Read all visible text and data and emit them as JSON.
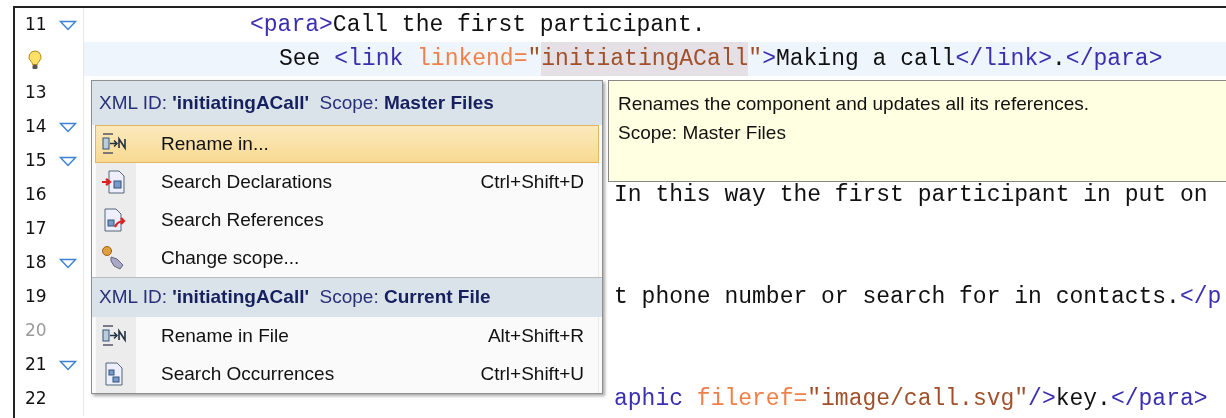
{
  "editor": {
    "lines": [
      {
        "number": "11",
        "fold": true,
        "current": false,
        "dimmed": false,
        "kind": "code",
        "segments": [
          {
            "kind": "tag",
            "text": "<para>"
          },
          {
            "kind": "text",
            "text": "Call the first participant."
          }
        ]
      },
      {
        "fold": false,
        "current": true,
        "kind": "code",
        "segments": [
          {
            "kind": "text",
            "text": "See "
          },
          {
            "kind": "tag",
            "text": "<link "
          },
          {
            "kind": "attr",
            "text": "linkend="
          },
          {
            "kind": "value",
            "text": "\""
          },
          {
            "kind": "value",
            "text": "initiatingACall",
            "highlighted": true
          },
          {
            "kind": "value",
            "text": "\""
          },
          {
            "kind": "tag",
            "text": ">"
          },
          {
            "kind": "text",
            "text": "Making a call"
          },
          {
            "kind": "tag",
            "text": "</link>"
          },
          {
            "kind": "text",
            "text": "."
          },
          {
            "kind": "tag",
            "text": "</para>"
          }
        ]
      },
      {
        "number": "13",
        "fold": false,
        "current": false,
        "dimmed": false
      },
      {
        "number": "14",
        "fold": true,
        "current": false,
        "dimmed": false
      },
      {
        "number": "15",
        "fold": true,
        "current": false,
        "dimmed": false
      },
      {
        "number": "16",
        "fold": false,
        "current": false,
        "dimmed": false,
        "kind": "tail",
        "segments": [
          {
            "kind": "text",
            "text": "In this way the first participant in put on"
          }
        ]
      },
      {
        "number": "17",
        "fold": false,
        "current": false,
        "dimmed": false
      },
      {
        "number": "18",
        "fold": true,
        "current": false,
        "dimmed": false
      },
      {
        "number": "19",
        "fold": false,
        "current": false,
        "dimmed": false,
        "kind": "tail",
        "segments": [
          {
            "kind": "text",
            "text": "t phone number or search for in contacts."
          },
          {
            "kind": "tag",
            "text": "</p"
          }
        ]
      },
      {
        "number": "20",
        "fold": false,
        "current": false,
        "dimmed": true
      },
      {
        "number": "21",
        "fold": true,
        "current": false,
        "dimmed": false
      },
      {
        "number": "22",
        "fold": false,
        "current": false,
        "dimmed": false,
        "kind": "tail",
        "segments": [
          {
            "kind": "tag",
            "text": "aphic "
          },
          {
            "kind": "attr",
            "text": "fileref="
          },
          {
            "kind": "value",
            "text": "\"image/call.svg\""
          },
          {
            "kind": "tag",
            "text": "/>"
          },
          {
            "kind": "text",
            "text": "key."
          },
          {
            "kind": "tag",
            "text": "</para>"
          }
        ]
      }
    ]
  },
  "popup": {
    "sections": [
      {
        "header": "XML ID: **'initiatingACall'**  Scope: **Master Files**",
        "items": [
          {
            "label": "Rename in...",
            "selected": true
          },
          {
            "label": "Search Declarations",
            "shortcut": "Ctrl+Shift+D",
            "selected": false
          },
          {
            "label": "Search References",
            "selected": false
          },
          {
            "label": "Change scope...",
            "selected": false
          }
        ]
      },
      {
        "header": "XML ID: **'initiatingACall'**  Scope: **Current File**",
        "items": [
          {
            "label": "Rename in File",
            "shortcut": "Alt+Shift+R",
            "selected": false
          },
          {
            "label": "Search Occurrences",
            "shortcut": "Ctrl+Shift+U",
            "selected": false
          }
        ]
      }
    ]
  },
  "tooltip": {
    "lines": [
      "Renames the component and updates all its references.",
      "Scope: Master Files"
    ]
  }
}
